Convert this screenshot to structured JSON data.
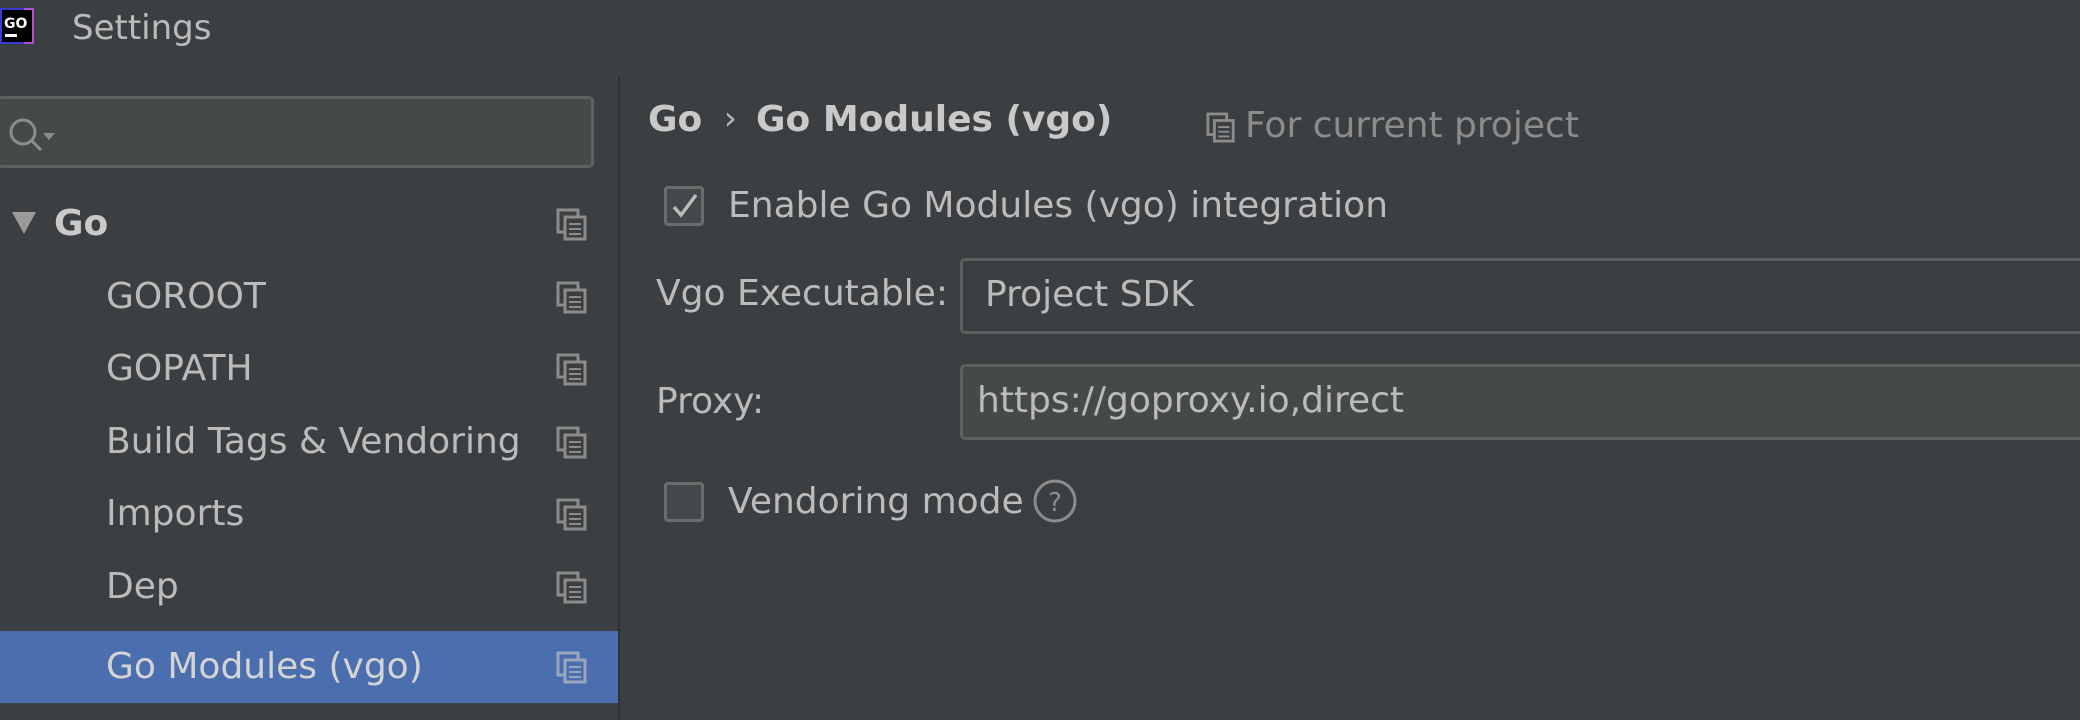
{
  "window": {
    "title": "Settings",
    "logo_text": "GO",
    "logo_icon": "goland-logo-icon"
  },
  "sidebar": {
    "search": {
      "value": "",
      "placeholder": "",
      "icon": "search-icon"
    },
    "items": [
      {
        "label": "Go",
        "expanded": true,
        "level": 0
      },
      {
        "label": "GOROOT",
        "level": 1
      },
      {
        "label": "GOPATH",
        "level": 1
      },
      {
        "label": "Build Tags & Vendoring",
        "level": 1
      },
      {
        "label": "Imports",
        "level": 1
      },
      {
        "label": "Dep",
        "level": 1
      },
      {
        "label": "Go Modules (vgo)",
        "level": 1,
        "selected": true
      }
    ],
    "item_icon": "project-scope-icon"
  },
  "main": {
    "breadcrumb": {
      "parent": "Go",
      "separator": "›",
      "current": "Go Modules (vgo)"
    },
    "scope_label": "For current project",
    "enable_modules": {
      "label": "Enable Go Modules (vgo) integration",
      "checked": true
    },
    "vgo_executable": {
      "label": "Vgo Executable:",
      "value": "Project SDK"
    },
    "proxy": {
      "label": "Proxy:",
      "value": "https://goproxy.io,direct"
    },
    "vendoring_mode": {
      "label": "Vendoring mode",
      "checked": false,
      "help_icon": "help-icon"
    }
  },
  "colors": {
    "background": "#3c3f41",
    "selection": "#4b6eaf",
    "text": "#bbbbbb",
    "muted_text": "#8c8c8c"
  }
}
